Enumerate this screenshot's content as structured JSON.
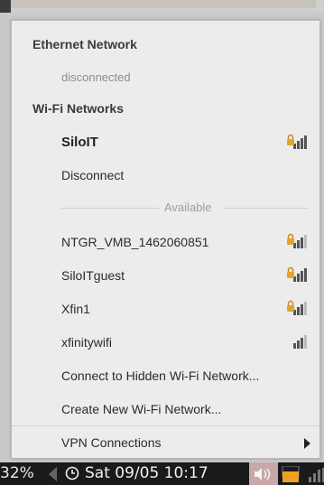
{
  "menu": {
    "ethernet_header": "Ethernet Network",
    "ethernet_status": "disconnected",
    "wifi_header": "Wi-Fi Networks",
    "connected_network": "SiloIT",
    "disconnect": "Disconnect",
    "available_label": "Available",
    "networks": [
      {
        "name": "NTGR_VMB_1462060851",
        "secured": true
      },
      {
        "name": "SiloITguest",
        "secured": true
      },
      {
        "name": "Xfin1",
        "secured": true
      },
      {
        "name": "xfinitywifi",
        "secured": false
      }
    ],
    "hidden_network": "Connect to Hidden Wi-Fi Network...",
    "create_network": "Create New Wi-Fi Network...",
    "vpn": "VPN Connections"
  },
  "taskbar": {
    "battery_percent": "32%",
    "clock": "Sat 09/05 10:17"
  },
  "colors": {
    "signal_bar": "#555555",
    "lock": "#e0a52a",
    "battery": "#f0a020",
    "volume_highlight": "#c8a8a8"
  }
}
